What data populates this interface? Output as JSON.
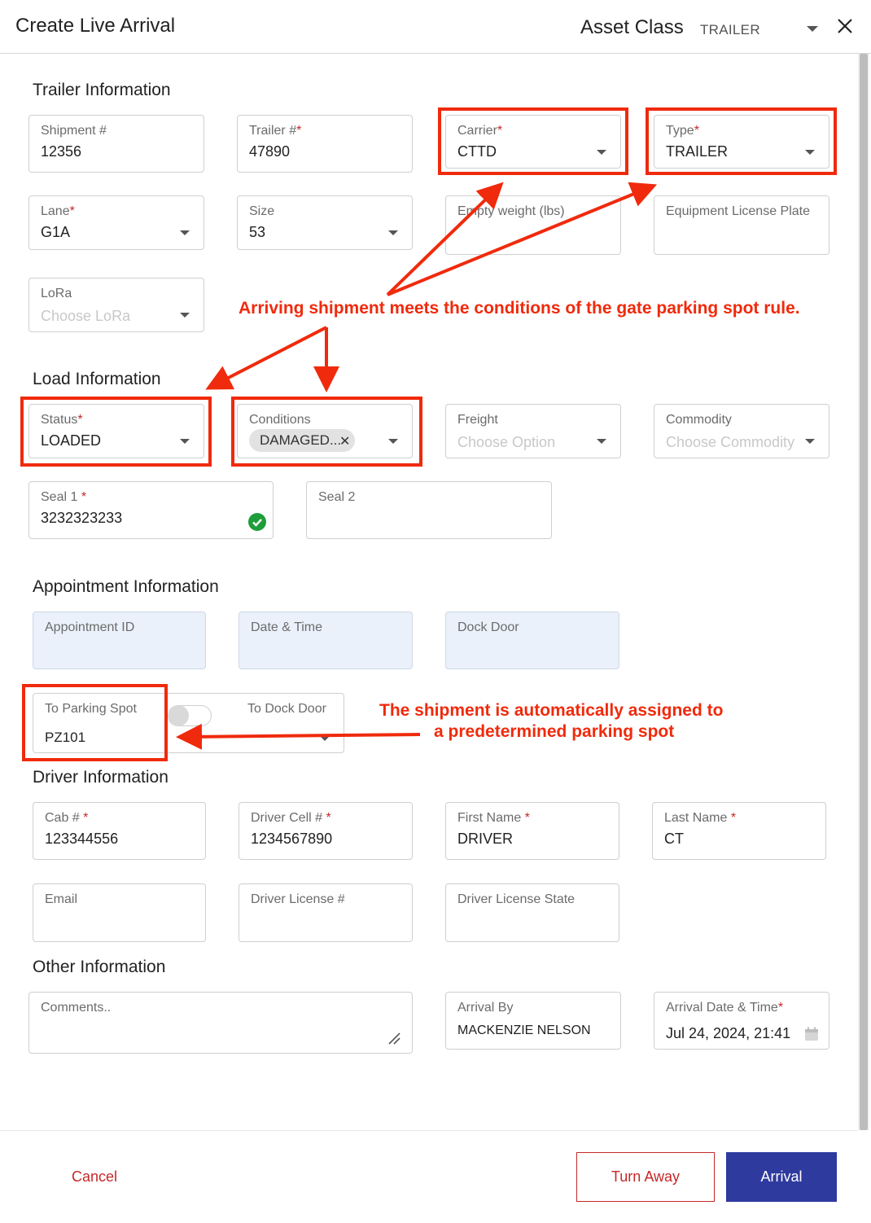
{
  "header": {
    "title": "Create Live Arrival",
    "asset_class_label": "Asset Class",
    "asset_class_value": "TRAILER"
  },
  "sections": {
    "trailer": "Trailer Information",
    "load": "Load Information",
    "appointment": "Appointment Information",
    "driver": "Driver Information",
    "other": "Other Information"
  },
  "trailer": {
    "shipment": {
      "label": "Shipment #",
      "value": "12356"
    },
    "trailer_no": {
      "label": "Trailer #",
      "value": "47890"
    },
    "carrier": {
      "label": "Carrier",
      "value": "CTTD"
    },
    "type": {
      "label": "Type",
      "value": "TRAILER"
    },
    "lane": {
      "label": "Lane",
      "value": "G1A"
    },
    "size": {
      "label": "Size",
      "value": "53"
    },
    "empty_weight": {
      "label": "Empty weight (lbs)"
    },
    "license_plate": {
      "label": "Equipment License Plate"
    },
    "lora": {
      "label": "LoRa",
      "placeholder": "Choose LoRa"
    }
  },
  "load": {
    "status": {
      "label": "Status",
      "value": "LOADED"
    },
    "conditions": {
      "label": "Conditions",
      "chip": "DAMAGED..."
    },
    "freight": {
      "label": "Freight",
      "placeholder": "Choose Option"
    },
    "commodity": {
      "label": "Commodity",
      "placeholder": "Choose Commodity"
    },
    "seal1": {
      "label": "Seal 1 ",
      "value": "3232323233"
    },
    "seal2": {
      "label": "Seal 2"
    }
  },
  "appointment": {
    "appointment_id": {
      "label": "Appointment ID"
    },
    "date_time": {
      "label": "Date & Time"
    },
    "dock_door": {
      "label": "Dock Door"
    },
    "parking_spot": {
      "label": "To Parking Spot",
      "value": "PZ101"
    },
    "to_dock_door": {
      "label": "To Dock Door"
    }
  },
  "driver": {
    "cab": {
      "label": "Cab # ",
      "value": "123344556"
    },
    "cell": {
      "label": "Driver Cell # ",
      "value": "1234567890"
    },
    "first_name": {
      "label": "First Name ",
      "value": "DRIVER"
    },
    "last_name": {
      "label": "Last Name ",
      "value": "CT"
    },
    "email": {
      "label": "Email"
    },
    "license": {
      "label": "Driver License #"
    },
    "license_state": {
      "label": "Driver License State"
    }
  },
  "other": {
    "comments": {
      "placeholder": "Comments.."
    },
    "arrival_by": {
      "label": "Arrival By",
      "value": "MACKENZIE NELSON"
    },
    "arrival_datetime": {
      "label": "Arrival Date & Time",
      "value": "Jul 24, 2024, 21:41"
    }
  },
  "required_mark": "*",
  "footer": {
    "cancel": "Cancel",
    "turn_away": "Turn Away",
    "arrival": "Arrival"
  },
  "annotations": {
    "rule_note": "Arriving shipment meets the conditions of the gate parking spot rule.",
    "assign_note_line1": "The shipment is automatically assigned to",
    "assign_note_line2": "a predetermined parking spot"
  },
  "colors": {
    "accent": "#2f3a9e",
    "danger": "#c62828",
    "annotation": "#f02a0c",
    "filled_field": "#eaf1fb",
    "success": "#1e9e3a"
  },
  "icons": [
    "close-icon",
    "chevron-down-icon",
    "check-circle-icon",
    "resize-handle-icon",
    "calendar-icon",
    "chip-remove-icon"
  ]
}
